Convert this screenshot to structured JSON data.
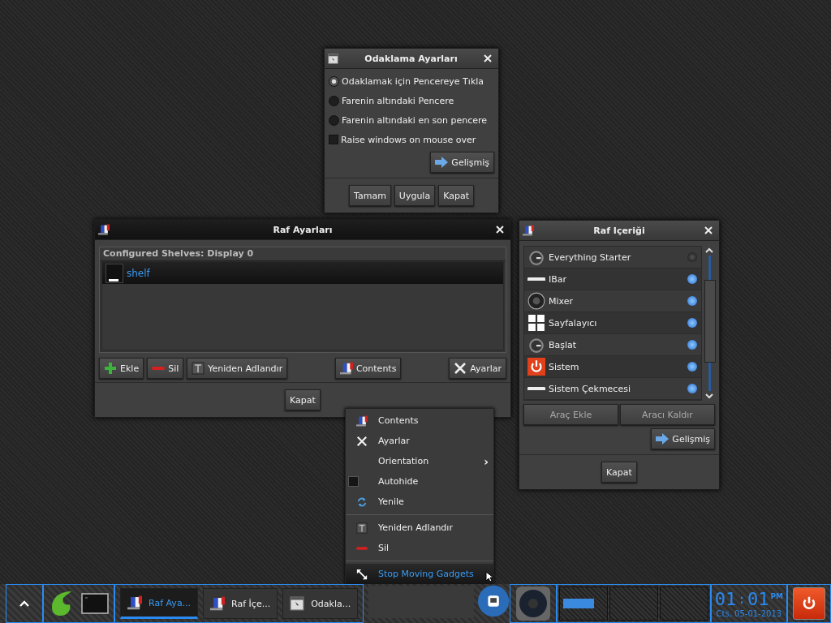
{
  "focus_window": {
    "title": "Odaklama Ayarları",
    "options": [
      {
        "label": "Odaklamak için Pencereye Tıkla",
        "selected": true
      },
      {
        "label": "Farenin altındaki Pencere",
        "selected": false
      },
      {
        "label": "Farenin altındaki en son pencere",
        "selected": false
      }
    ],
    "raise": {
      "label": "Raise windows on mouse over",
      "checked": false
    },
    "advanced_button": "Gelişmiş",
    "buttons": [
      "Tamam",
      "Uygula",
      "Kapat"
    ]
  },
  "shelf_window": {
    "title": "Raf Ayarları",
    "list_header": "Configured Shelves: Display 0",
    "shelves": [
      {
        "name": "shelf",
        "selected": true
      }
    ],
    "buttons": [
      "Ekle",
      "Sil",
      "Yeniden Adlandır",
      "Contents",
      "Ayarlar"
    ],
    "close_button": "Kapat"
  },
  "contents_window": {
    "title": "Raf Içeriği",
    "gadgets": [
      {
        "name": "Everything Starter",
        "enabled": false
      },
      {
        "name": "IBar",
        "enabled": true
      },
      {
        "name": "Mixer",
        "enabled": true
      },
      {
        "name": "Sayfalayıcı",
        "enabled": true
      },
      {
        "name": "Başlat",
        "enabled": true
      },
      {
        "name": "Sistem",
        "enabled": true
      },
      {
        "name": "Sistem Çekmecesi",
        "enabled": true
      }
    ],
    "buttons": [
      "Araç Ekle",
      "Aracı Kaldır"
    ],
    "advanced_button": "Gelişmiş",
    "close_button": "Kapat"
  },
  "context_menu": {
    "items": [
      {
        "kind": "item",
        "label": "Contents",
        "selected": false
      },
      {
        "kind": "item",
        "label": "Ayarlar",
        "selected": false
      },
      {
        "kind": "submenu",
        "label": "Orientation",
        "submenu_marker": "›",
        "selected": false
      },
      {
        "kind": "check",
        "label": "Autohide",
        "checked": false,
        "selected": false
      },
      {
        "kind": "item",
        "label": "Yenile",
        "selected": false
      },
      {
        "kind": "separator"
      },
      {
        "kind": "item",
        "label": "Yeniden Adlandır",
        "selected": false
      },
      {
        "kind": "item",
        "label": "Sil",
        "selected": false
      },
      {
        "kind": "separator"
      },
      {
        "kind": "item",
        "label": "Stop Moving Gadgets",
        "selected": true
      }
    ]
  },
  "taskbar": {
    "tasks": [
      {
        "label": "Raf Aya...",
        "selected": true
      },
      {
        "label": "Raf İçe...",
        "selected": false
      },
      {
        "label": "Odakla...",
        "selected": false
      }
    ],
    "clock": {
      "hours": "01",
      "separator": ":",
      "minutes": "01",
      "ampm": "PM",
      "date": "Cts, 05-01-2013"
    }
  }
}
